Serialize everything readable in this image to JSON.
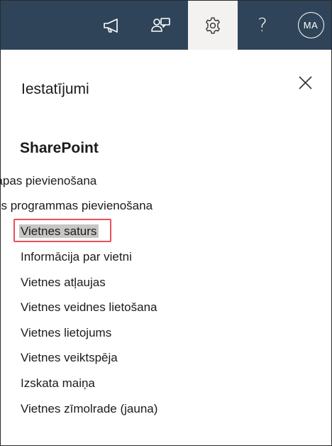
{
  "topbar": {
    "icons": [
      "megaphone-icon",
      "chat-icon",
      "gear-icon",
      "help-icon"
    ],
    "help_glyph": "?",
    "avatar_initials": "MA",
    "background": "#2f4459",
    "active_tab_background": "#f3f2f1"
  },
  "panel": {
    "title": "Iestatījumi",
    "close_icon": "close-icon",
    "section_title": "SharePoint",
    "items": [
      {
        "label": "Lapas pievienošana"
      },
      {
        "label": "Lietotnes programmas pievienošana"
      },
      {
        "label": "Vietnes saturs",
        "highlighted": true
      },
      {
        "label": "Informācija par vietni"
      },
      {
        "label": "Vietnes atļaujas"
      },
      {
        "label": "Vietnes veidnes lietošana"
      },
      {
        "label": "Vietnes lietojums"
      },
      {
        "label": "Vietnes veiktspēja"
      },
      {
        "label": "Izskata maiņa"
      },
      {
        "label": "Vietnes zīmolrade (jauna)"
      }
    ]
  },
  "highlight_color": "#e8515a"
}
